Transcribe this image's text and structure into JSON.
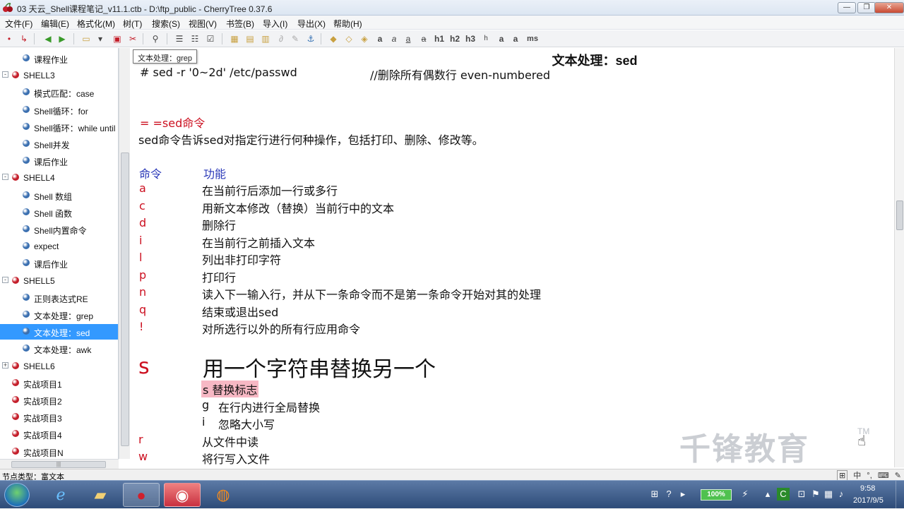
{
  "window": {
    "title": "03 天云_Shell课程笔记_v11.1.ctb - D:\\ftp_public - CherryTree 0.37.6",
    "minimize": "—",
    "maximize": "❐",
    "close": "✕"
  },
  "menu": [
    "文件(F)",
    "编辑(E)",
    "格式化(M)",
    "树(T)",
    "搜索(S)",
    "视图(V)",
    "书签(B)",
    "导入(I)",
    "导出(X)",
    "帮助(H)"
  ],
  "toolbar": {
    "format_buttons": [
      "a",
      "a",
      "a",
      "h1",
      "h2",
      "h3",
      "a",
      "a",
      "ms"
    ]
  },
  "tooltip": "文本处理：grep",
  "tree": {
    "nodes": [
      {
        "label": "课程作业",
        "level": 1,
        "color": "#3a6fb0"
      },
      {
        "label": "SHELL3",
        "level": 0,
        "color": "#c41e2a",
        "expander": "-"
      },
      {
        "label": "模式匹配：case",
        "level": 1,
        "color": "#3a6fb0"
      },
      {
        "label": "Shell循环：for",
        "level": 1,
        "color": "#3a6fb0"
      },
      {
        "label": "Shell循环：while until",
        "level": 1,
        "color": "#3a6fb0"
      },
      {
        "label": "Shell并发",
        "level": 1,
        "color": "#3a6fb0"
      },
      {
        "label": "课后作业",
        "level": 1,
        "color": "#3a6fb0"
      },
      {
        "label": "SHELL4",
        "level": 0,
        "color": "#c41e2a",
        "expander": "-"
      },
      {
        "label": "Shell 数组",
        "level": 1,
        "color": "#3a6fb0"
      },
      {
        "label": "Shell 函数",
        "level": 1,
        "color": "#3a6fb0"
      },
      {
        "label": "Shell内置命令",
        "level": 1,
        "color": "#3a6fb0"
      },
      {
        "label": "expect",
        "level": 1,
        "color": "#3a6fb0"
      },
      {
        "label": "课后作业",
        "level": 1,
        "color": "#3a6fb0"
      },
      {
        "label": "SHELL5",
        "level": 0,
        "color": "#c41e2a",
        "expander": "-"
      },
      {
        "label": "正则表达式RE",
        "level": 1,
        "color": "#3a6fb0"
      },
      {
        "label": "文本处理：grep",
        "level": 1,
        "color": "#3a6fb0"
      },
      {
        "label": "文本处理：sed",
        "level": 1,
        "color": "#3a6fb0",
        "selected": true
      },
      {
        "label": "文本处理：awk",
        "level": 1,
        "color": "#3a6fb0"
      },
      {
        "label": "SHELL6",
        "level": 0,
        "color": "#c41e2a",
        "expander": "+"
      },
      {
        "label": "实战项目1",
        "level": 0,
        "color": "#c41e2a"
      },
      {
        "label": "实战项目2",
        "level": 0,
        "color": "#c41e2a"
      },
      {
        "label": "实战项目3",
        "level": 0,
        "color": "#c41e2a"
      },
      {
        "label": "实战项目4",
        "level": 0,
        "color": "#c41e2a"
      },
      {
        "label": "实战项目N",
        "level": 0,
        "color": "#c41e2a"
      }
    ]
  },
  "editor": {
    "node_title": "文本处理：sed",
    "top_line_code": "# sed -r '0~2d' /etc/passwd",
    "top_line_comment": "//删除所有偶数行 even-numbered",
    "section_heading": "= =sed命令",
    "intro": "sed命令告诉sed对指定行进行何种操作，包括打印、删除、修改等。",
    "table_header": {
      "cmd": "命令",
      "func": "功能"
    },
    "commands": [
      {
        "cmd": "a",
        "desc": "在当前行后添加一行或多行"
      },
      {
        "cmd": "c",
        "desc": "用新文本修改（替换）当前行中的文本"
      },
      {
        "cmd": "d",
        "desc": "删除行"
      },
      {
        "cmd": "i",
        "desc": "在当前行之前插入文本"
      },
      {
        "cmd": "l",
        "desc": "列出非打印字符"
      },
      {
        "cmd": "p",
        "desc": "打印行"
      },
      {
        "cmd": "n",
        "desc": "读入下一输入行，并从下一条命令而不是第一条命令开始对其的处理"
      },
      {
        "cmd": "q",
        "desc": "结束或退出sed"
      },
      {
        "cmd": "!",
        "desc": "对所选行以外的所有行应用命令"
      }
    ],
    "s_cmd": "s",
    "s_desc": "用一个字符串替换另一个",
    "s_flags_title": "s 替换标志",
    "s_flags": [
      {
        "flag": "g",
        "desc": "在行内进行全局替换"
      },
      {
        "flag": "i",
        "desc": "忽略大小写"
      }
    ],
    "more_commands": [
      {
        "cmd": "r",
        "desc": "从文件中读"
      },
      {
        "cmd": "w",
        "desc": "将行写入文件"
      }
    ]
  },
  "statusbar": {
    "node_type": "节点类型：富文本",
    "ime": [
      "中",
      "°,",
      "⌨",
      "✎"
    ]
  },
  "watermark": {
    "text": "千锋教育",
    "tm": "TM"
  },
  "taskbar": {
    "battery": "100%",
    "time": "9:58",
    "date": "2017/9/5"
  },
  "colors": {
    "command_red": "#cc1020",
    "header_blue": "#2a38b8",
    "selected_blue": "#3399ff",
    "highlight_pink": "#f7b8c4"
  }
}
